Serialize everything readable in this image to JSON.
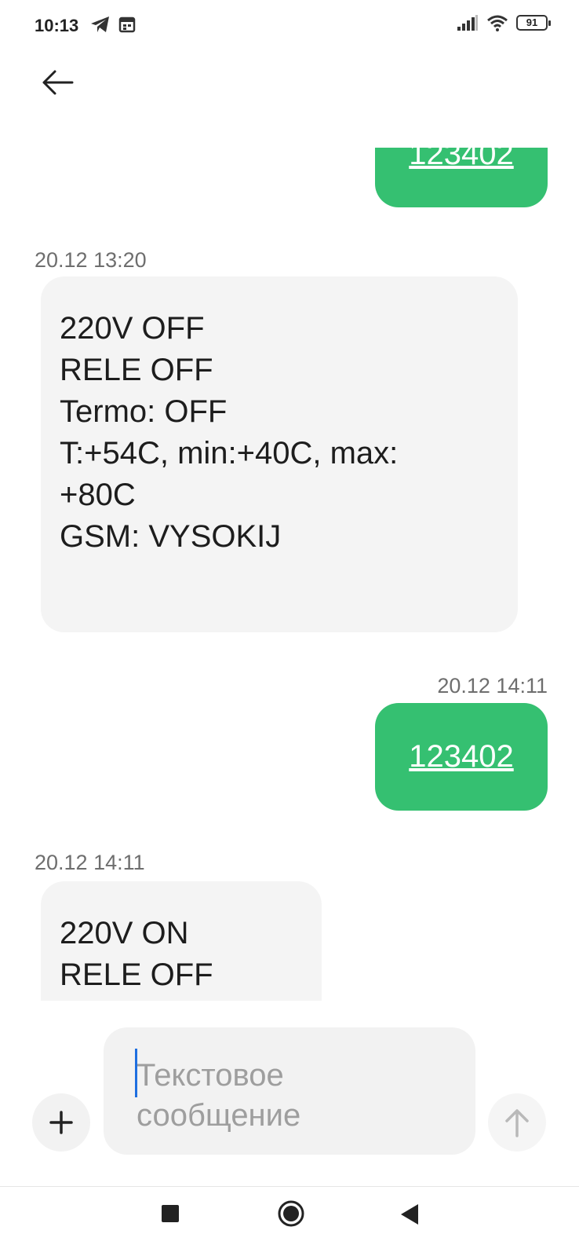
{
  "status_bar": {
    "time": "10:13",
    "battery": "91",
    "left_icons": [
      "telegram-icon",
      "calendar-icon"
    ],
    "right_icons": [
      "signal-icon",
      "wifi-icon",
      "battery-icon"
    ]
  },
  "header": {
    "back_icon": "arrow-left-icon"
  },
  "messages": [
    {
      "direction": "outgoing",
      "text": "123402",
      "partial": true
    },
    {
      "direction": "incoming",
      "timestamp": "20.12 13:20",
      "lines": [
        "220V OFF",
        "RELE OFF",
        "Termo: OFF",
        "T:+54C, min:+40C, max:",
        "+80C",
        "GSM: VYSOKIJ"
      ]
    },
    {
      "direction": "outgoing",
      "timestamp": "20.12 14:11",
      "text": "123402"
    },
    {
      "direction": "incoming",
      "timestamp": "20.12 14:11",
      "lines": [
        "220V ON",
        "RELE OFF"
      ],
      "partial": true
    }
  ],
  "composer": {
    "placeholder": "Текстовое\nсообщение",
    "add_icon": "plus-icon",
    "send_icon": "arrow-up-icon"
  },
  "nav_bar": {
    "icons": [
      "square-recents-icon",
      "circle-home-icon",
      "triangle-back-icon"
    ]
  },
  "colors": {
    "outgoing_bubble": "#35c071",
    "incoming_bubble": "#f4f4f4",
    "caret": "#1e6fe0"
  }
}
